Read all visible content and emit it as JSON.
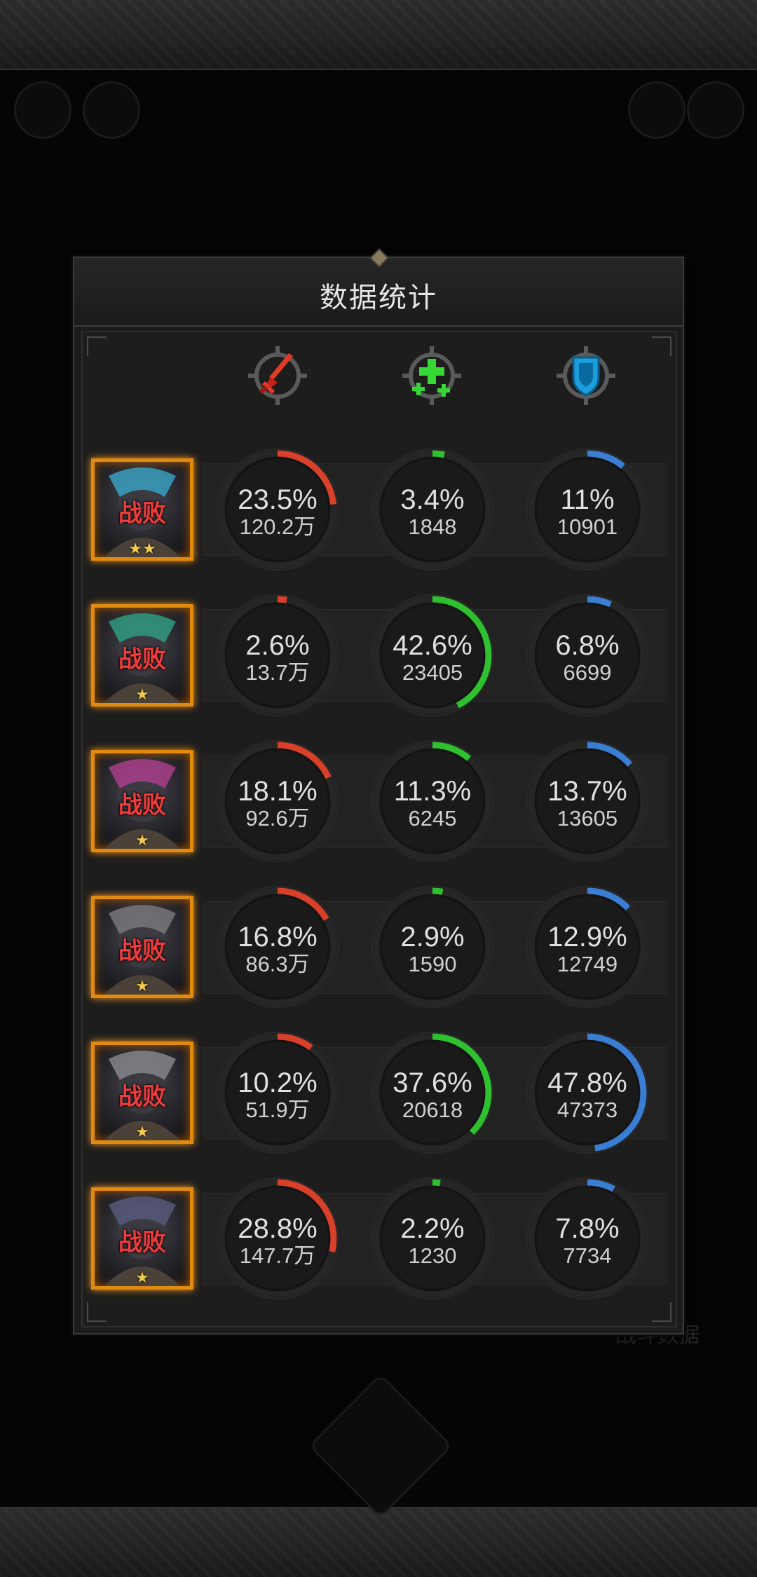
{
  "panel": {
    "title": "数据统计"
  },
  "columns": [
    {
      "key": "damage",
      "icon": "sword-icon",
      "color": "#d8402a"
    },
    {
      "key": "heal",
      "icon": "heal-cross-icon",
      "color": "#2fc02f"
    },
    {
      "key": "tank",
      "icon": "shield-icon",
      "color": "#3a7ed4"
    }
  ],
  "rows": [
    {
      "status": "战败",
      "stars": "★★",
      "damage": {
        "pct": "23.5%",
        "value": "120.2万",
        "fill": 0.235
      },
      "heal": {
        "pct": "3.4%",
        "value": "1848",
        "fill": 0.034
      },
      "tank": {
        "pct": "11%",
        "value": "10901",
        "fill": 0.11
      }
    },
    {
      "status": "战败",
      "stars": "★",
      "damage": {
        "pct": "2.6%",
        "value": "13.7万",
        "fill": 0.026
      },
      "heal": {
        "pct": "42.6%",
        "value": "23405",
        "fill": 0.426
      },
      "tank": {
        "pct": "6.8%",
        "value": "6699",
        "fill": 0.068
      }
    },
    {
      "status": "战败",
      "stars": "★",
      "damage": {
        "pct": "18.1%",
        "value": "92.6万",
        "fill": 0.181
      },
      "heal": {
        "pct": "11.3%",
        "value": "6245",
        "fill": 0.113
      },
      "tank": {
        "pct": "13.7%",
        "value": "13605",
        "fill": 0.137
      }
    },
    {
      "status": "战败",
      "stars": "★",
      "damage": {
        "pct": "16.8%",
        "value": "86.3万",
        "fill": 0.168
      },
      "heal": {
        "pct": "2.9%",
        "value": "1590",
        "fill": 0.029
      },
      "tank": {
        "pct": "12.9%",
        "value": "12749",
        "fill": 0.129
      }
    },
    {
      "status": "战败",
      "stars": "★",
      "damage": {
        "pct": "10.2%",
        "value": "51.9万",
        "fill": 0.102
      },
      "heal": {
        "pct": "37.6%",
        "value": "20618",
        "fill": 0.376
      },
      "tank": {
        "pct": "47.8%",
        "value": "47373",
        "fill": 0.478
      }
    },
    {
      "status": "战败",
      "stars": "★",
      "damage": {
        "pct": "28.8%",
        "value": "147.7万",
        "fill": 0.288
      },
      "heal": {
        "pct": "2.2%",
        "value": "1230",
        "fill": 0.022
      },
      "tank": {
        "pct": "7.8%",
        "value": "7734",
        "fill": 0.078
      }
    }
  ],
  "background": {
    "partial_label": "战斗数据"
  }
}
